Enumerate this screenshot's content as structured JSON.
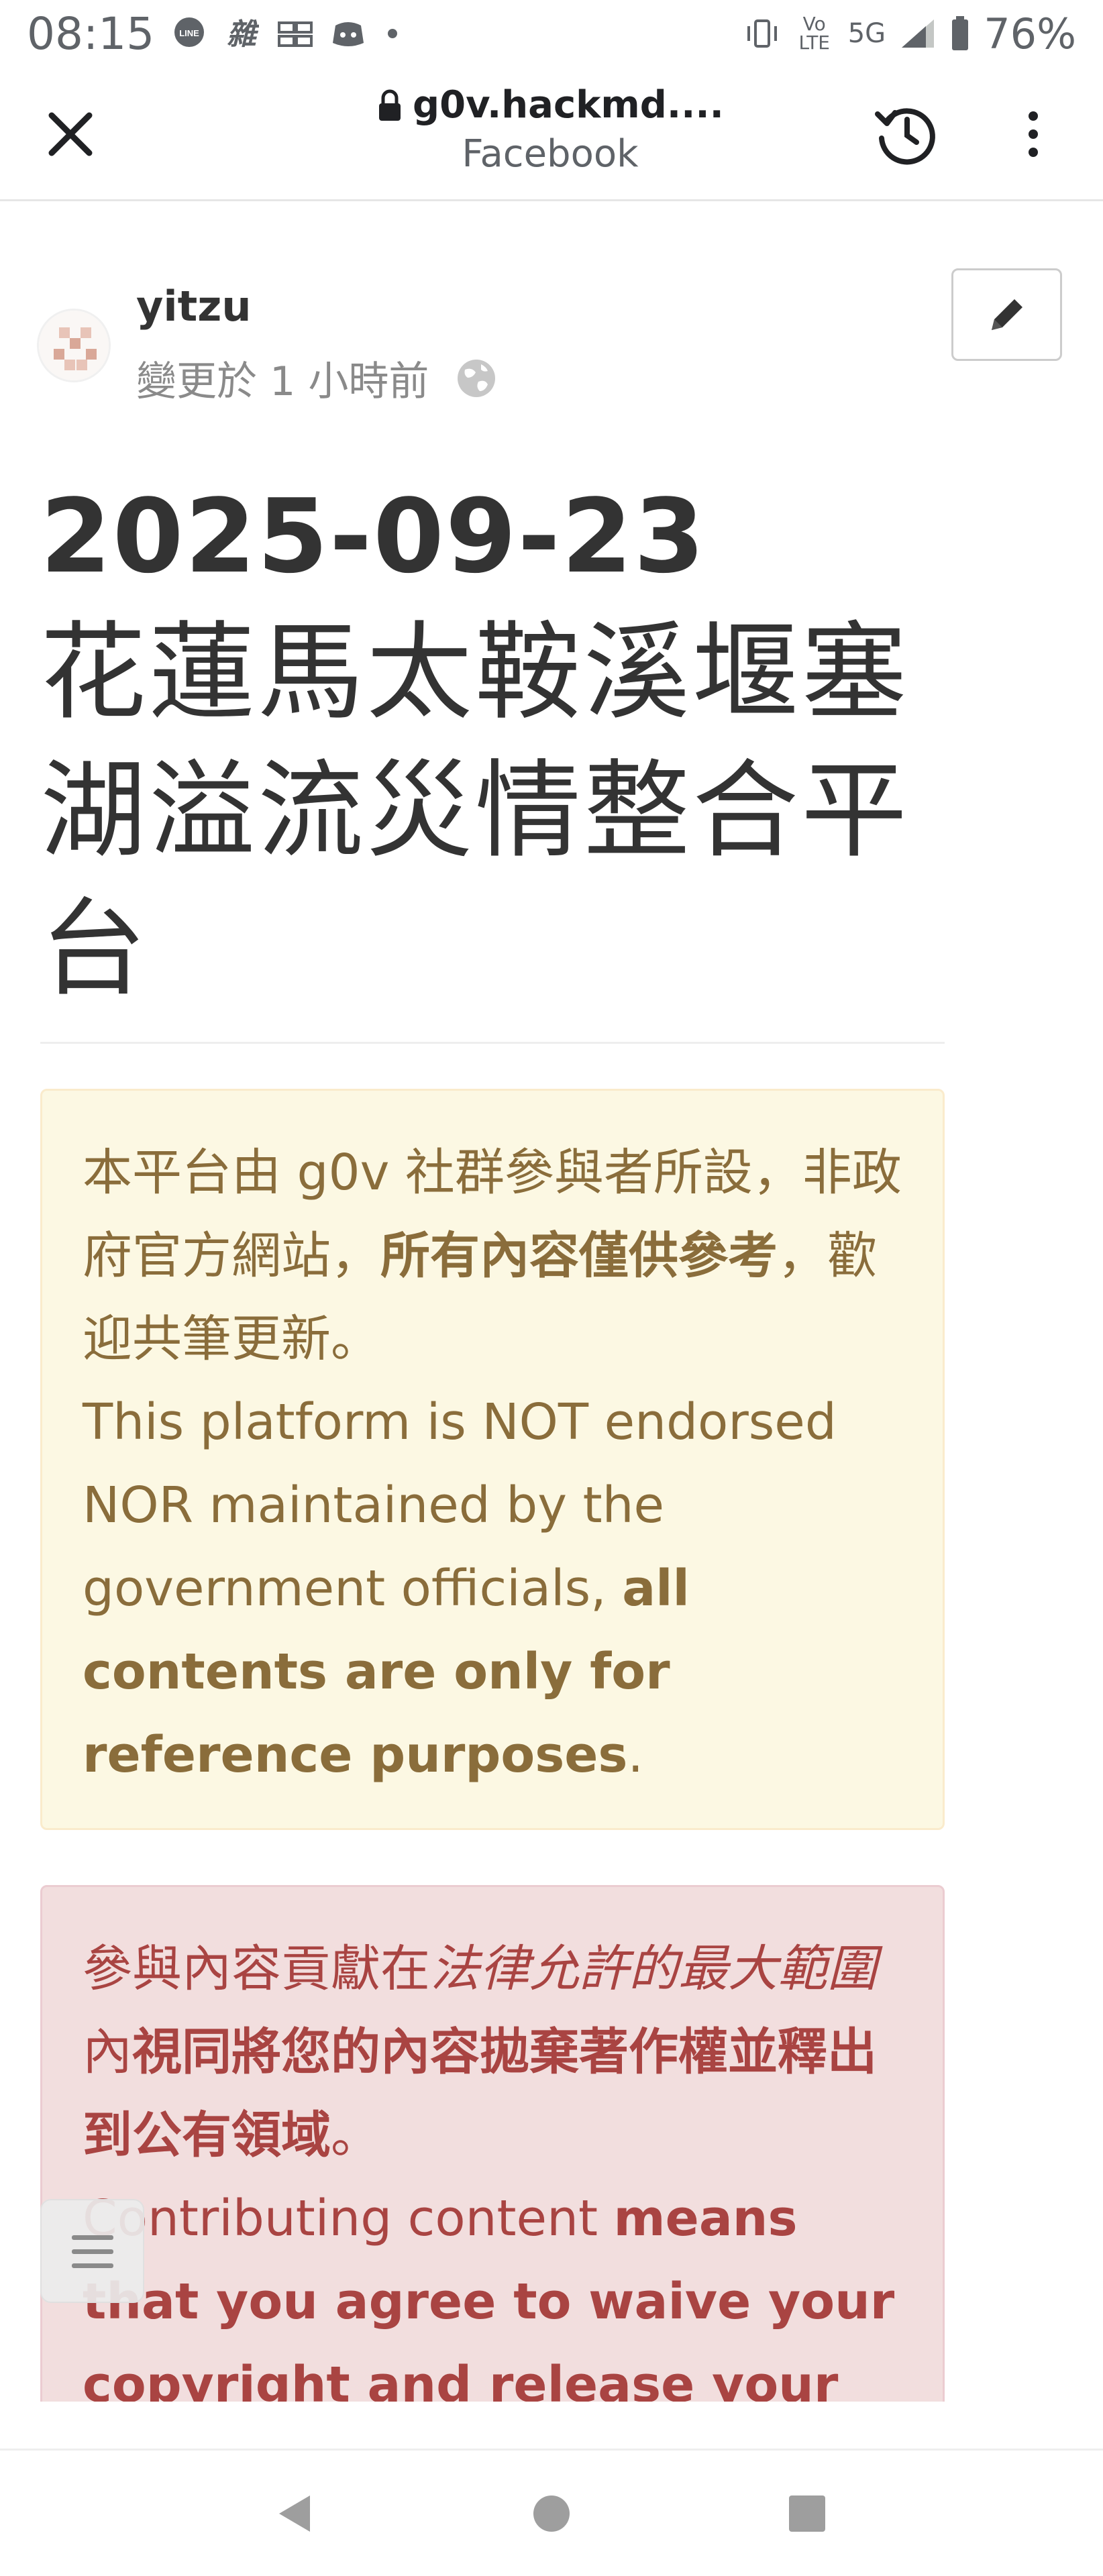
{
  "status_bar": {
    "time": "08:15",
    "network": "5G",
    "volte_label": "Vo LTE",
    "battery": "76%",
    "icons": [
      "line-icon",
      "app-icon",
      "app-icon",
      "discord-icon",
      "dot-icon",
      "vibrate-icon",
      "volte-icon",
      "signal-icon",
      "battery-icon"
    ]
  },
  "browser": {
    "url": "g0v.hackmd....",
    "page_name": "Facebook"
  },
  "author": {
    "name": "yitzu",
    "changed": "變更於 1 小時前"
  },
  "title": {
    "date": "2025-09-23",
    "lines": [
      "花蓮馬太鞍溪堰塞",
      "湖溢流災情整合平",
      "台"
    ]
  },
  "warning": {
    "zh_1": "本平台由 g0v 社群參與者所設，非政府官方網站，",
    "zh_bold": "所有內容僅供參考",
    "zh_2": "，歡迎共筆更新。",
    "en_1": "This platform is NOT endorsed NOR maintained by the government officials, ",
    "en_bold": "all contents are only for reference purposes",
    "en_2": "."
  },
  "danger": {
    "zh_1": "參與內容貢獻在",
    "zh_italic": "法律允許的最大範圍",
    "zh_2": "內",
    "zh_bold": "視同將您的內容拋棄著作權並釋出到公有領域",
    "zh_3": "。",
    "en_1": "Contributing content ",
    "en_bold": "means that you agree to waive your copyright and release your content to the Public Domain"
  },
  "colors": {
    "warning_bg": "#fcf8e3",
    "warning_text": "#8a6d3b",
    "danger_bg": "#f2dede",
    "danger_text": "#a94442"
  }
}
